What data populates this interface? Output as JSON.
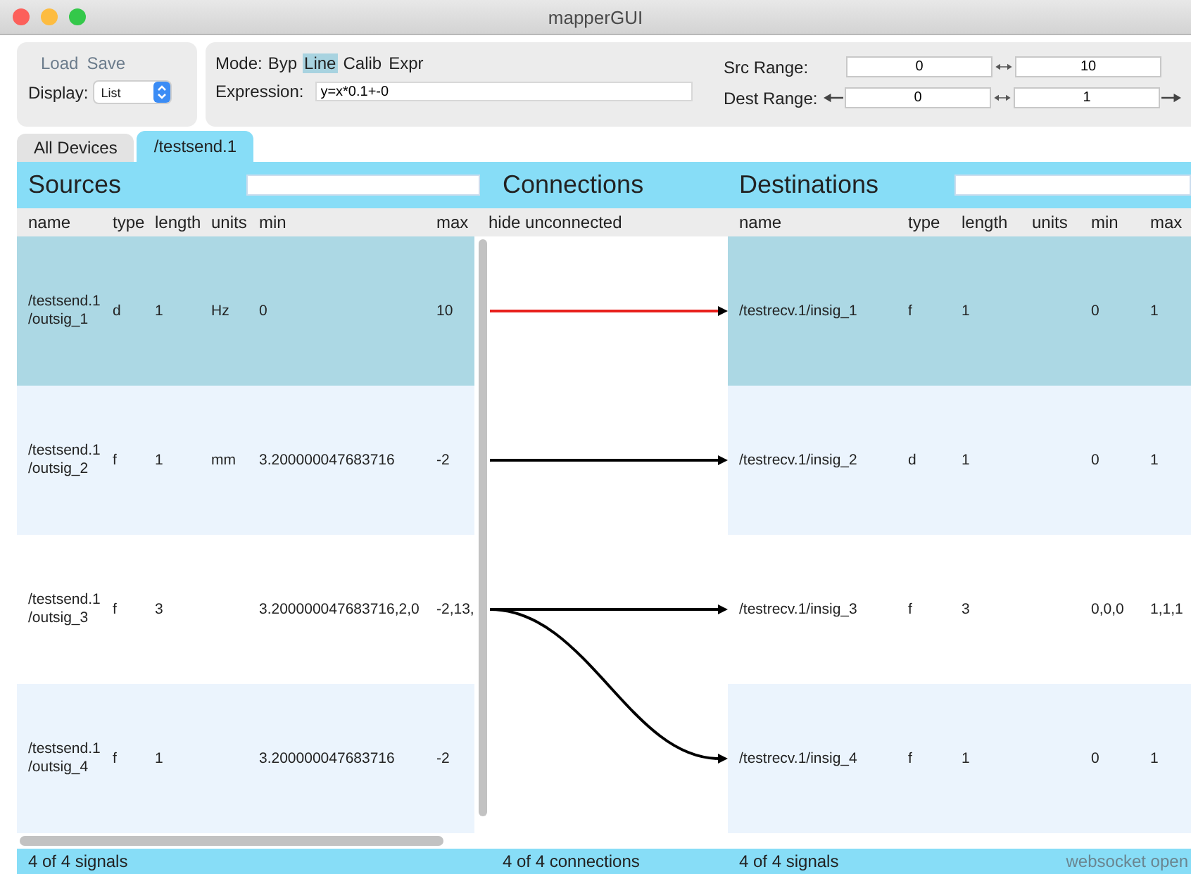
{
  "window": {
    "title": "mapperGUI"
  },
  "file_actions": [
    "Load",
    "Save"
  ],
  "display": {
    "label": "Display:",
    "value": "List"
  },
  "mode": {
    "label": "Mode:",
    "options": [
      {
        "label": "Byp",
        "selected": false
      },
      {
        "label": "Line",
        "selected": true
      },
      {
        "label": "Calib",
        "selected": false
      },
      {
        "label": "Expr",
        "selected": false
      }
    ]
  },
  "expression": {
    "label": "Expression:",
    "value": "y=x*0.1+-0"
  },
  "src_range": {
    "label": "Src Range:",
    "min": "0",
    "max": "10"
  },
  "dest_range": {
    "label": "Dest Range:",
    "min": "0",
    "max": "1"
  },
  "tabs": [
    {
      "label": "All Devices",
      "selected": false
    },
    {
      "label": "/testsend.1",
      "selected": true
    }
  ],
  "sources": {
    "title": "Sources",
    "columns": [
      "name",
      "type",
      "length",
      "units",
      "min",
      "max"
    ],
    "rows": [
      {
        "name": "/testsend.1/outsig_1",
        "type": "d",
        "length": "1",
        "units": "Hz",
        "min": "0",
        "max": "10",
        "selected": true,
        "links": [
          {
            "kind": "straight",
            "selected": true
          }
        ]
      },
      {
        "name": "/testsend.1/outsig_2",
        "type": "f",
        "length": "1",
        "units": "mm",
        "min": "3.200000047683716",
        "max": "-2",
        "selected": false,
        "links": [
          {
            "kind": "straight",
            "selected": false
          }
        ]
      },
      {
        "name": "/testsend.1/outsig_3",
        "type": "f",
        "length": "3",
        "units": "",
        "min": "3.200000047683716,2,0",
        "max": "-2,13,",
        "selected": false,
        "links": [
          {
            "kind": "straight",
            "selected": false
          },
          {
            "kind": "down",
            "selected": false
          }
        ]
      },
      {
        "name": "/testsend.1/outsig_4",
        "type": "f",
        "length": "1",
        "units": "",
        "min": "3.200000047683716",
        "max": "-2",
        "selected": false
      }
    ],
    "footer": "4 of 4 signals"
  },
  "connections": {
    "title": "Connections",
    "filter_label": "hide unconnected",
    "footer": "4 of 4 connections"
  },
  "destinations": {
    "title": "Destinations",
    "columns": [
      "name",
      "type",
      "length",
      "units",
      "min",
      "max"
    ],
    "rows": [
      {
        "name": "/testrecv.1/insig_1",
        "type": "f",
        "length": "1",
        "units": "",
        "min": "0",
        "max": "1",
        "selected": true
      },
      {
        "name": "/testrecv.1/insig_2",
        "type": "d",
        "length": "1",
        "units": "",
        "min": "0",
        "max": "1",
        "selected": false
      },
      {
        "name": "/testrecv.1/insig_3",
        "type": "f",
        "length": "3",
        "units": "",
        "min": "0,0,0",
        "max": "1,1,1",
        "selected": false
      },
      {
        "name": "/testrecv.1/insig_4",
        "type": "f",
        "length": "1",
        "units": "",
        "min": "0",
        "max": "1",
        "selected": false
      }
    ],
    "footer": "4 of 4 signals"
  },
  "status": "websocket open"
}
